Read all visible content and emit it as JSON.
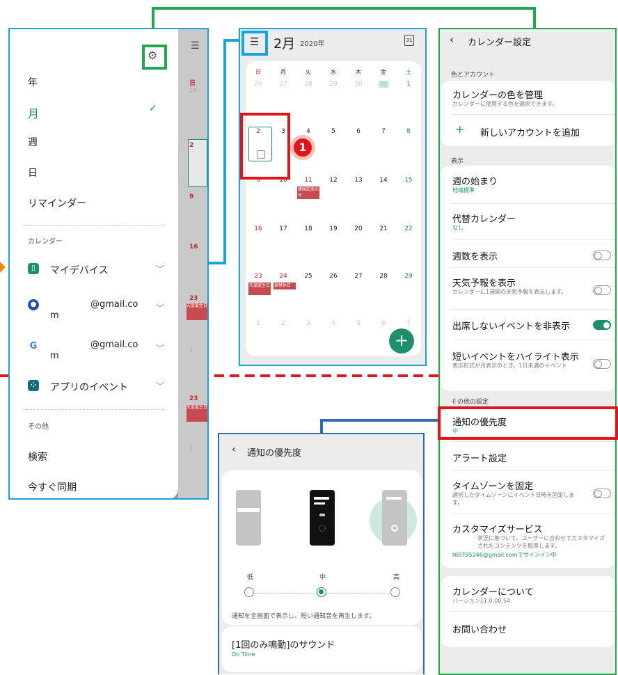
{
  "drawer": {
    "views": [
      "年",
      "月",
      "週",
      "日",
      "リマインダー"
    ],
    "calendars_header": "カレンダー",
    "calendars": [
      {
        "name": "マイデバイス",
        "icon": "phone-icon"
      },
      {
        "name": "@gmail.co",
        "suffix": "m",
        "icon": "samsung-account-icon"
      },
      {
        "name": "@gmail.co",
        "suffix": "m",
        "icon": "google-icon"
      },
      {
        "name": "アプリのイベント",
        "icon": "apps-icon"
      }
    ],
    "other_header": "その他",
    "search": "検索",
    "sync_now": "今すぐ同期",
    "strip_days": [
      "日",
      "26",
      "2",
      "9",
      "16",
      "23",
      "1",
      "23",
      "1"
    ],
    "strip_events": [
      "天皇誕生日",
      "天皇誕生日"
    ]
  },
  "calendar": {
    "month": "2月",
    "year": "2020年",
    "today_icon": "31",
    "weekdays": [
      "日",
      "月",
      "火",
      "水",
      "木",
      "金",
      "土"
    ],
    "weeks": [
      [
        "26",
        "27",
        "28",
        "29",
        "30",
        "31",
        "1"
      ],
      [
        "2",
        "3",
        "4",
        "5",
        "6",
        "7",
        "8"
      ],
      [
        "9",
        "10",
        "11",
        "12",
        "13",
        "14",
        "15"
      ],
      [
        "16",
        "17",
        "18",
        "19",
        "20",
        "21",
        "22"
      ],
      [
        "23",
        "24",
        "25",
        "26",
        "27",
        "28",
        "29"
      ],
      [
        "1",
        "2",
        "3",
        "4",
        "5",
        "6",
        "7"
      ]
    ],
    "events": [
      "建国記念の日",
      "天皇誕生日",
      "振替休日"
    ],
    "fab": "+",
    "marker": "1"
  },
  "settings": {
    "title": "カレンダー設定",
    "sec_color": "色とアカウント",
    "manage_colors": "カレンダーの色を管理",
    "manage_colors_sub": "カレンダーに使用する色を選択できます。",
    "add_account": "新しいアカウントを追加",
    "sec_display": "表示",
    "week_start": "週の始まり",
    "week_start_val": "地域標準",
    "alt_calendar": "代替カレンダー",
    "alt_calendar_val": "なし",
    "show_week_num": "週数を表示",
    "weather": "天気予報を表示",
    "weather_sub": "カレンダーに1週間の天気予報を表示します。",
    "hide_declined": "出席しないイベントを非表示",
    "highlight": "短いイベントをハイライト表示",
    "highlight_sub": "表示形式が月表示のとき、1日未満のイベント",
    "sec_other": "その他の設定",
    "notif_priority": "通知の優先度",
    "notif_priority_val": "中",
    "alert_settings": "アラート設定",
    "lock_tz": "タイムゾーンを固定",
    "lock_tz_sub": "選択したタイムゾーンにイベント日時を固定します。",
    "customize": "カスタマイズサービス",
    "customize_sub": "状況に基づいて、ユーザーに合わせてカスタマイズされたコンテンツを取得します。",
    "customize_account": "t60795246@gmail.comでサインイン中",
    "about": "カレンダーについて",
    "version": "バージョン11.0.00.54",
    "contact": "お問い合わせ"
  },
  "notif": {
    "title": "通知の優先度",
    "levels": [
      "低",
      "中",
      "高"
    ],
    "selected": "中",
    "description": "通知を全画面で表示し、短い通知音を再生します。",
    "sound": "[1回のみ鳴動]のサウンド",
    "sound_val": "On Time"
  },
  "colors": {
    "accent": "#1e8f6e",
    "red": "#e3131b",
    "blue": "#1aa3e0",
    "green": "#1fa84f"
  }
}
